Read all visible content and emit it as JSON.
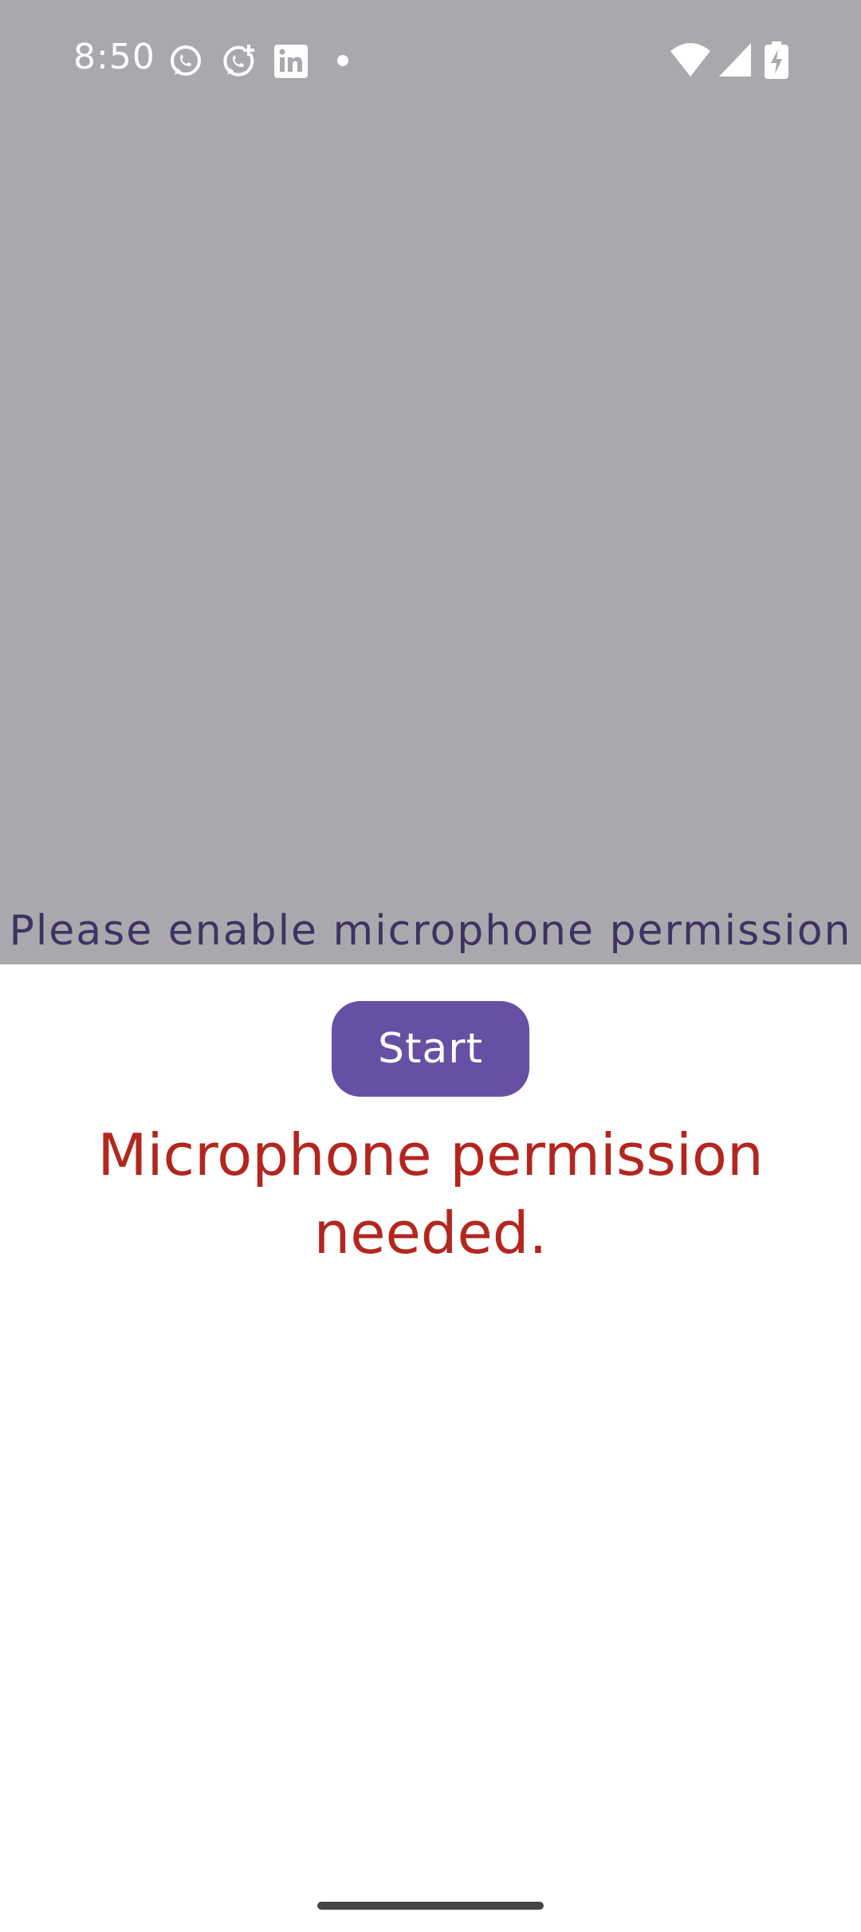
{
  "status_bar": {
    "time": "8:50",
    "notification_icons": [
      "whatsapp-icon",
      "whatsapp-business-icon",
      "linkedin-icon",
      "more-dot-icon"
    ],
    "system_icons": [
      "wifi-icon",
      "cellular-signal-icon",
      "battery-charging-icon"
    ]
  },
  "main": {
    "permission_hint": "Please enable microphone permission",
    "start_label": "Start",
    "error_message": "Microphone permission needed."
  },
  "colors": {
    "overlay_gray": "#aba8ad",
    "accent_purple": "#6750a4",
    "error_red": "#b3261e",
    "hint_text": "#3d3363"
  }
}
